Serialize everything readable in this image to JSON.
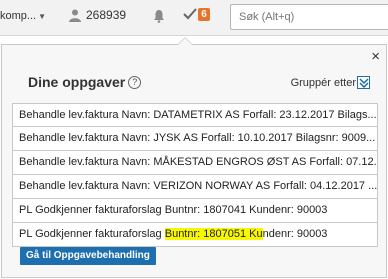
{
  "topbar": {
    "company": "komp...",
    "user_count": "268939",
    "task_badge": "6",
    "search_placeholder": "Søk (Alt+q)"
  },
  "popup": {
    "title": "Dine oppgaver",
    "help": "?",
    "group_label": "Gruppér etter",
    "close": "×",
    "tasks": [
      {
        "text": "Behandle lev.faktura Navn: DATAMETRIX AS Forfall: 23.12.2017 Bilags..."
      },
      {
        "text": "Behandle lev.faktura Navn: JYSK AS Forfall: 10.10.2017 Bilagsnr: 9009..."
      },
      {
        "text": "Behandle lev.faktura Navn: MÅKESTAD ENGROS ØST AS Forfall: 07.12...."
      },
      {
        "text": "Behandle lev.faktura Navn: VERIZON NORWAY AS Forfall: 04.12.2017 ..."
      },
      {
        "text": "PL Godkjenner fakturaforslag Buntnr: 1807041 Kundenr: 90003"
      },
      {
        "pre": "PL Godkjenner fakturaforslag ",
        "highlight": "Buntnr: 1807051 Ku",
        "post": "ndenr: 90003"
      }
    ],
    "button_label": "Gå til Oppgavebehandling"
  },
  "colors": {
    "accent": "#1e6fad",
    "badge": "#e8742a",
    "highlight": "#f7f700"
  }
}
